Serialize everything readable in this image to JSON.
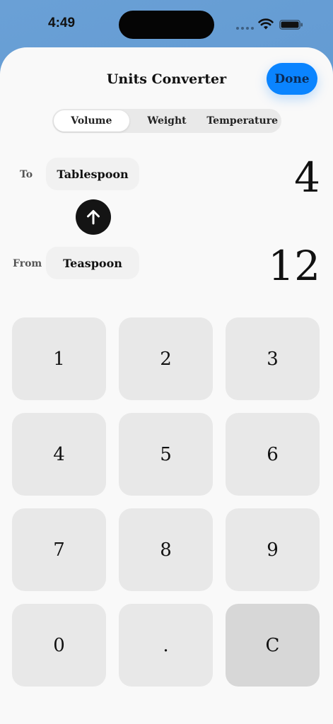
{
  "status_bar": {
    "time": "4:49"
  },
  "header": {
    "title": "Units Converter",
    "done_label": "Done"
  },
  "tabs": [
    {
      "label": "Volume",
      "selected": true
    },
    {
      "label": "Weight",
      "selected": false
    },
    {
      "label": "Temperature",
      "selected": false
    }
  ],
  "converter": {
    "to_label": "To",
    "to_unit": "Tablespoon",
    "to_value": "4",
    "from_label": "From",
    "from_unit": "Teaspoon",
    "from_value": "12",
    "swap_icon": "arrow-up-icon"
  },
  "keypad": {
    "keys": [
      "1",
      "2",
      "3",
      "4",
      "5",
      "6",
      "7",
      "8",
      "9",
      "0",
      ".",
      "C"
    ]
  },
  "colors": {
    "accent": "#0a84ff",
    "background": "#f9f9f9",
    "key": "#e8e8e8",
    "clear_key": "#d7d7d7"
  }
}
